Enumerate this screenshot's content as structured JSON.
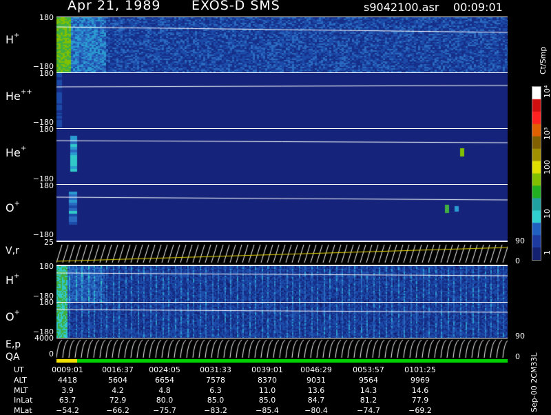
{
  "header": {
    "date": "Apr 21, 1989",
    "instrument": "EXOS-D SMS",
    "file": "s9042100.asr",
    "time": "00:09:01"
  },
  "panels": [
    {
      "ion": "H",
      "charge": "+",
      "top": "180",
      "bottom": "−180"
    },
    {
      "ion": "He",
      "charge": "++",
      "top": "180",
      "bottom": "−180"
    },
    {
      "ion": "He",
      "charge": "+",
      "top": "180",
      "bottom": "−180"
    },
    {
      "ion": "O",
      "charge": "+",
      "top": "180",
      "bottom": "−180"
    }
  ],
  "vr_panel": {
    "label": "V,r",
    "top": "25",
    "bottom": "0",
    "right_top": "90",
    "right_bottom": "0"
  },
  "lower_panels": [
    {
      "ion": "H",
      "charge": "+",
      "top": "180",
      "bottom": "−180"
    },
    {
      "ion": "O",
      "charge": "+",
      "top": "180",
      "bottom": "−180"
    }
  ],
  "ep_panel": {
    "label1": "E,p",
    "label2": "QA",
    "top": "4000",
    "bottom": "0",
    "right_top": "90",
    "right_bottom": "0"
  },
  "colorbar": {
    "unit": "Ct/Smp",
    "ticks": [
      "10⁴",
      "10³",
      "100",
      "10",
      "1"
    ]
  },
  "side_note": "Sep-00  2CM33L",
  "table": {
    "row_labels": [
      "UT",
      "ALT",
      "MLT",
      "InLat",
      "MLat"
    ],
    "columns": [
      [
        "0009:01",
        "4418",
        "3.9",
        "63.7",
        "−54.2"
      ],
      [
        "0016:37",
        "5604",
        "4.2",
        "72.9",
        "−66.2"
      ],
      [
        "0024:05",
        "6654",
        "4.8",
        "80.0",
        "−75.7"
      ],
      [
        "0031:33",
        "7578",
        "6.3",
        "85.0",
        "−83.2"
      ],
      [
        "0039:01",
        "8370",
        "11.0",
        "85.0",
        "−85.4"
      ],
      [
        "0046:29",
        "9031",
        "13.6",
        "84.7",
        "−80.4"
      ],
      [
        "0053:57",
        "9564",
        "14.3",
        "81.2",
        "−74.7"
      ],
      [
        "0101:25",
        "9969",
        "14.6",
        "77.9",
        "−69.2"
      ]
    ]
  }
}
